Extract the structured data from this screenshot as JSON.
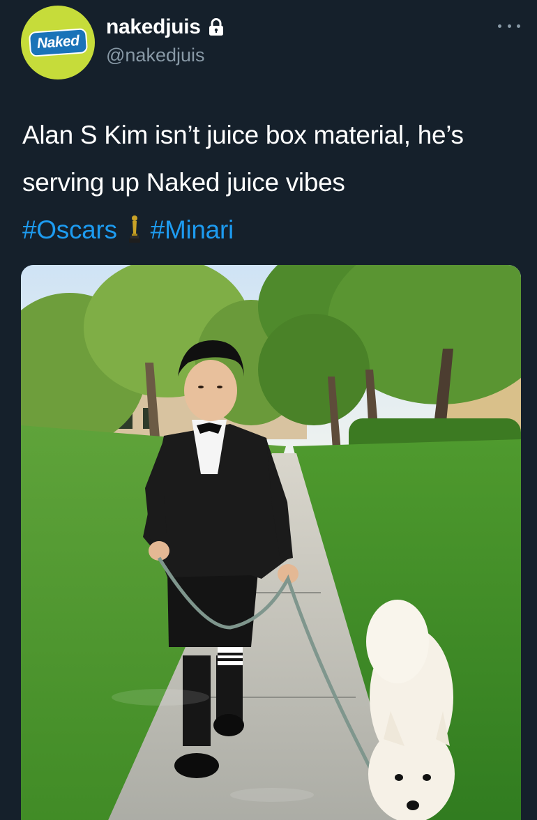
{
  "user": {
    "display_name": "nakedjuis",
    "handle": "@nakedjuis",
    "avatar_text": "Naked",
    "protected": true
  },
  "tweet": {
    "text_line1": "Alan S Kim isn’t juice box material, he’s",
    "text_line2": "serving up Naked juice vibes",
    "hashtag1": "#Oscars",
    "hashtag2": "#Minari"
  },
  "icons": {
    "lock": "lock-icon",
    "more": "more-dots-icon",
    "trophy": "oscar-statue-icon"
  },
  "colors": {
    "background": "#15202b",
    "text": "#ffffff",
    "secondary_text": "#8899a6",
    "hashtag": "#1d9bf0",
    "avatar_bg": "#c6dc3a",
    "avatar_logo": "#1a73b8"
  }
}
